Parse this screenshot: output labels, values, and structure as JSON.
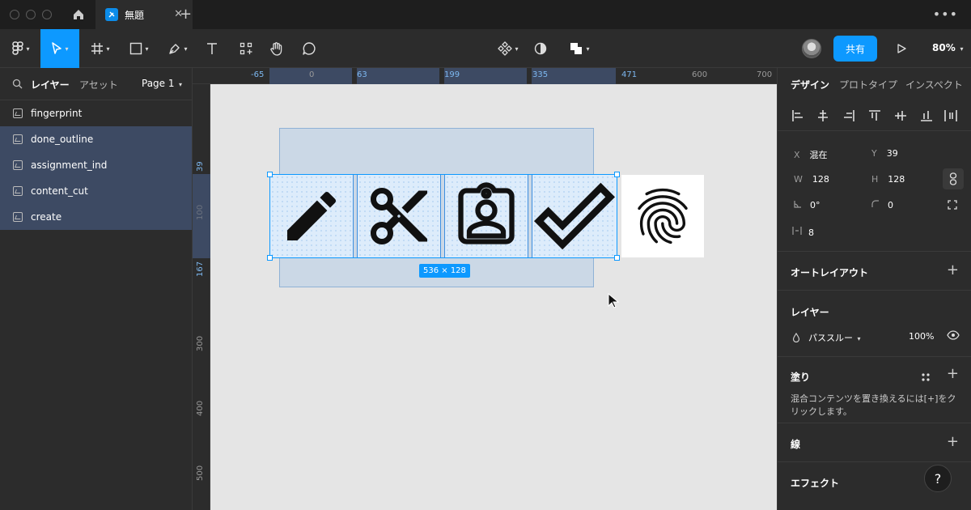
{
  "titlebar": {
    "tab_name": "無題",
    "tab_close": "✕",
    "new_tab": "+",
    "menu": "•••"
  },
  "toolbar": {
    "share_label": "共有",
    "zoom": "80%"
  },
  "left_panel": {
    "tab_layers": "レイヤー",
    "tab_assets": "アセット",
    "page_label": "Page 1",
    "layers": [
      {
        "name": "fingerprint",
        "selected": false
      },
      {
        "name": "done_outline",
        "selected": true
      },
      {
        "name": "assignment_ind",
        "selected": true
      },
      {
        "name": "content_cut",
        "selected": true
      },
      {
        "name": "create",
        "selected": true
      }
    ]
  },
  "rulers": {
    "top": [
      "-65",
      "0",
      "63",
      "199",
      "335",
      "471",
      "600",
      "700"
    ],
    "left": [
      "39",
      "100",
      "167",
      "300",
      "400",
      "500"
    ]
  },
  "canvas": {
    "size_badge": "536 × 128"
  },
  "right_panel": {
    "tab_design": "デザイン",
    "tab_prototype": "プロトタイプ",
    "tab_inspect": "インスペクト",
    "x_label": "X",
    "x_value": "混在",
    "y_label": "Y",
    "y_value": "39",
    "w_label": "W",
    "w_value": "128",
    "h_label": "H",
    "h_value": "128",
    "rotation": "0°",
    "radius": "0",
    "spacing": "8",
    "auto_layout": "オートレイアウト",
    "layer_title": "レイヤー",
    "blend_mode": "パススルー",
    "opacity": "100%",
    "fill_title": "塗り",
    "fill_note": "混合コンテンツを置き換えるには[+]をクリックします。",
    "stroke_title": "線",
    "effects_title": "エフェクト",
    "help": "?"
  },
  "colors": {
    "accent": "#0d99ff",
    "panel": "#2c2c2c",
    "canvas": "#e5e5e5",
    "selection": "#3d4a63"
  }
}
